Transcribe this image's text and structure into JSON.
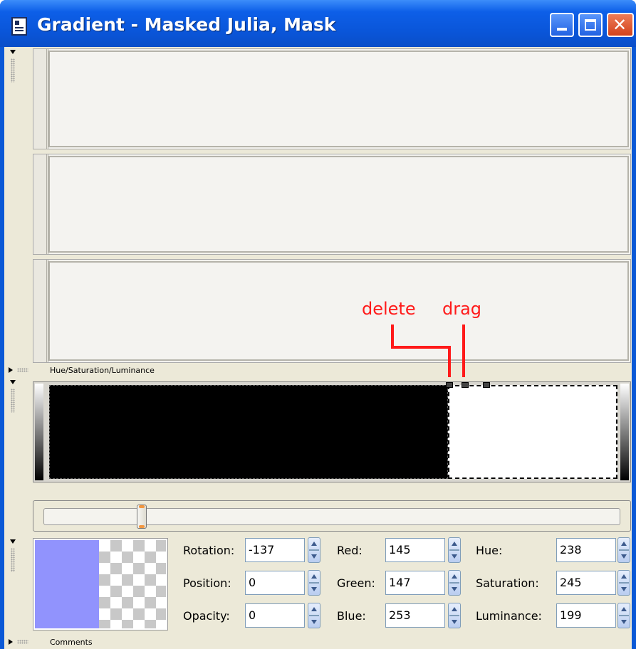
{
  "window": {
    "title": "Gradient - Masked Julia, Mask",
    "controls": {
      "minimize": "minimize",
      "maximize": "maximize",
      "close": "✕"
    }
  },
  "sections": {
    "hsl_label": "Hue/Saturation/Luminance",
    "comments_label": "Comments"
  },
  "annotations": {
    "delete": "delete",
    "drag": "drag"
  },
  "gradient": {
    "stop_color_left": "#000000",
    "stop_color_right": "#ffffff"
  },
  "slider": {
    "value_fraction": 0.165
  },
  "swatch": {
    "color": "#9193fd"
  },
  "fields": {
    "rotation": {
      "label": "Rotation:",
      "value": "-137"
    },
    "position": {
      "label": "Position:",
      "value": "0"
    },
    "opacity": {
      "label": "Opacity:",
      "value": "0"
    },
    "red": {
      "label": "Red:",
      "value": "145"
    },
    "green": {
      "label": "Green:",
      "value": "147"
    },
    "blue": {
      "label": "Blue:",
      "value": "253"
    },
    "hue": {
      "label": "Hue:",
      "value": "238"
    },
    "saturation": {
      "label": "Saturation:",
      "value": "245"
    },
    "luminance": {
      "label": "Luminance:",
      "value": "199"
    }
  },
  "colors": {
    "annotation": "#ff1a1a",
    "title_bar": "#0a55d8"
  }
}
